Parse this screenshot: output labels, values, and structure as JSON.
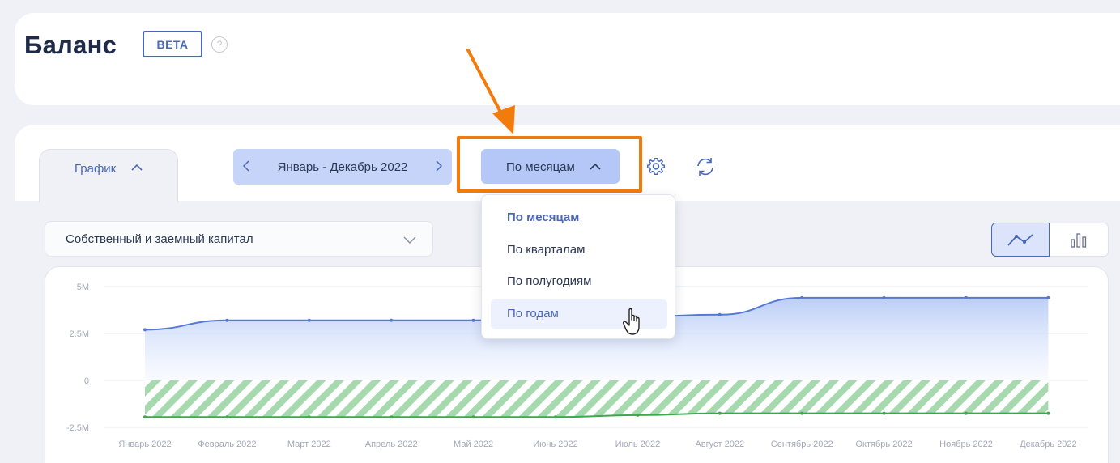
{
  "header": {
    "title": "Баланс",
    "badge": "BETA",
    "help": "?"
  },
  "tabs": [
    {
      "label": "График"
    }
  ],
  "period": {
    "label": "Январь - Декабрь 2022"
  },
  "grouping": {
    "selected": "По месяцам",
    "options": [
      "По месяцам",
      "По кварталам",
      "По полугодиям",
      "По годам"
    ],
    "hovered_index": 3
  },
  "filter": {
    "selected": "Собственный и заемный капитал"
  },
  "colors": {
    "accent": "#4a68b8",
    "highlight": "#f27b0c",
    "series_blue": "#5679d6",
    "series_green": "#3ea84e"
  },
  "icons": [
    "chevron-left-icon",
    "chevron-right-icon",
    "chevron-up-icon",
    "chevron-down-icon",
    "gear-icon",
    "refresh-icon",
    "line-chart-icon",
    "bar-chart-icon",
    "help-icon",
    "hand-cursor-icon"
  ],
  "chart_data": {
    "type": "area",
    "categories": [
      "Январь 2022",
      "Февраль 2022",
      "Март 2022",
      "Апрель 2022",
      "Май 2022",
      "Июнь 2022",
      "Июль 2022",
      "Август 2022",
      "Сентябрь 2022",
      "Октябрь 2022",
      "Ноябрь 2022",
      "Декабрь 2022"
    ],
    "y_ticks": [
      "5M",
      "2.5M",
      "0",
      "-2.5M"
    ],
    "ylim": [
      -2.5,
      5
    ],
    "grid": true,
    "series": [
      {
        "values": [
          2.7,
          3.2,
          3.2,
          3.2,
          3.2,
          3.3,
          3.4,
          3.5,
          4.4,
          4.4,
          4.4,
          4.4
        ],
        "color": "#5679d6"
      },
      {
        "values": [
          -1.95,
          -1.95,
          -1.95,
          -1.95,
          -1.95,
          -1.95,
          -1.85,
          -1.75,
          -1.75,
          -1.75,
          -1.75,
          -1.75
        ],
        "color": "#3ea84e"
      }
    ]
  }
}
